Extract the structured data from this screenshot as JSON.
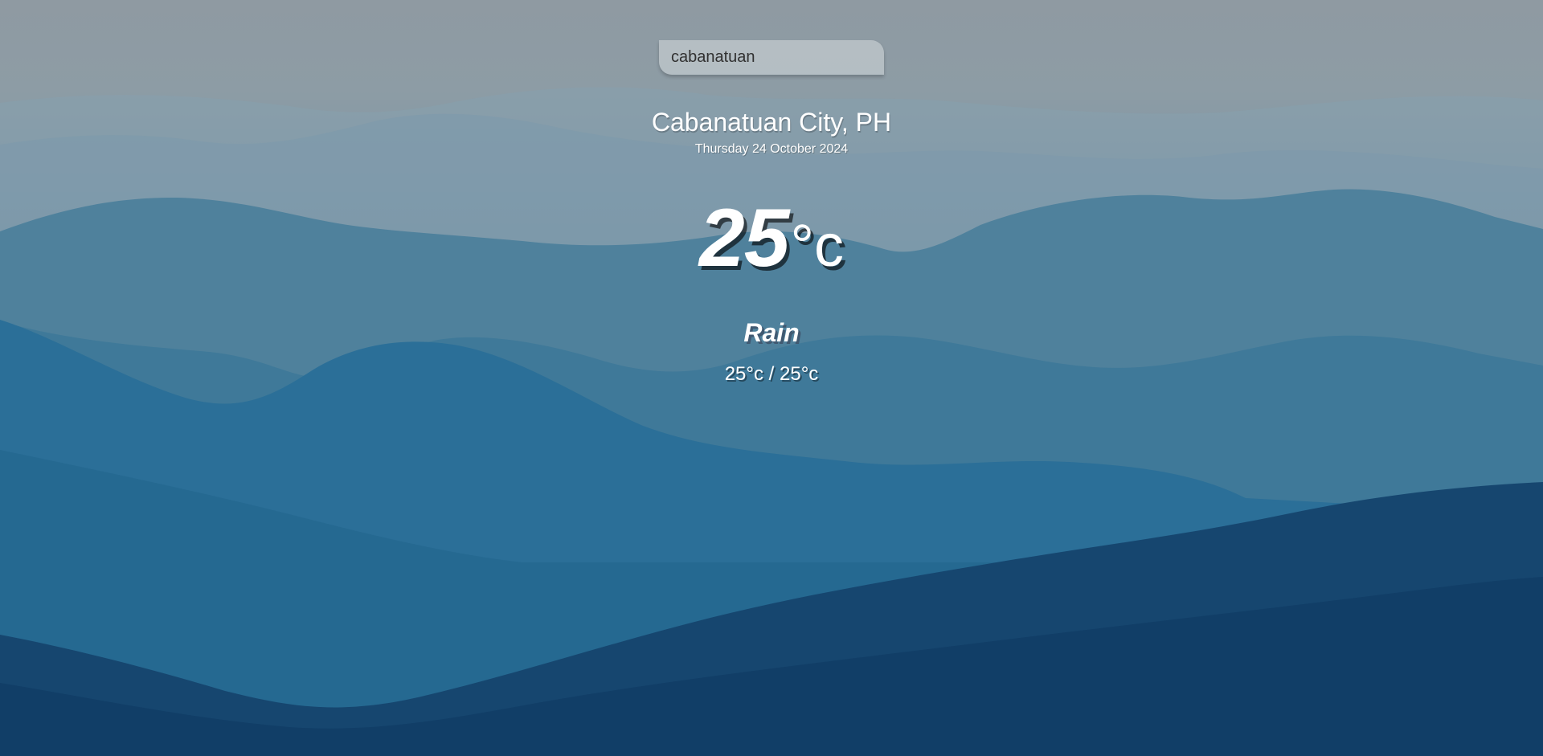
{
  "search": {
    "value": "cabanatuan"
  },
  "location": {
    "city": "Cabanatuan City, PH",
    "date": "Thursday 24 October 2024"
  },
  "current": {
    "temp": "25",
    "unit": "°c",
    "weather": "Rain",
    "hi_low": "25°c / 25°c"
  },
  "colors": {
    "sky": "#8f9aa2",
    "mountain_far": "#6f8fa3",
    "mountain_mid": "#2f6f97",
    "mountain_near": "#13436d",
    "text": "#ffffff"
  }
}
